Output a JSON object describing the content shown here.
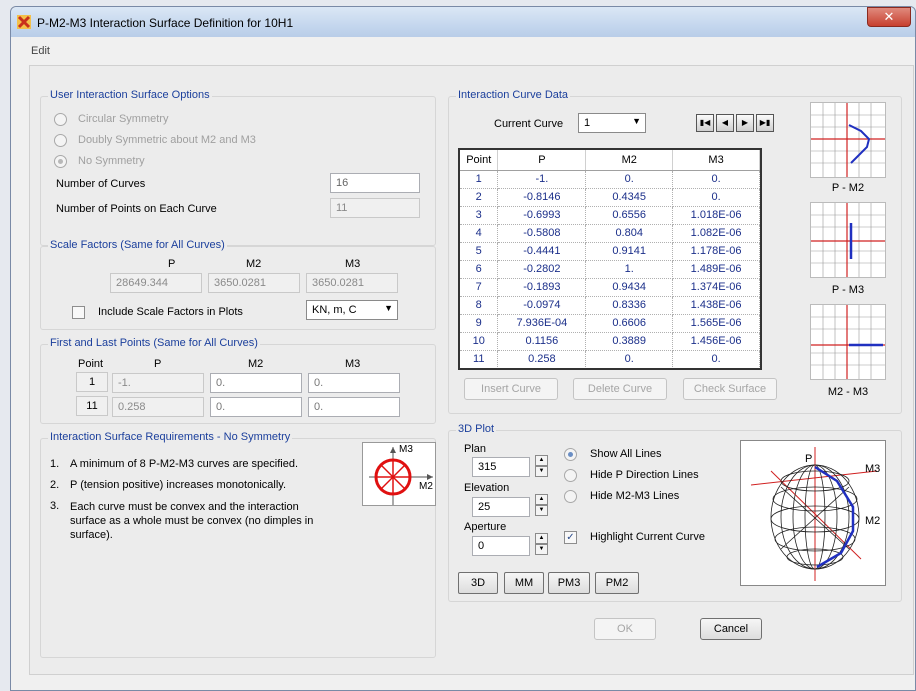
{
  "window": {
    "title": "P-M2-M3 Interaction Surface Definition for 10H1"
  },
  "menu": {
    "edit": "Edit"
  },
  "user_options": {
    "legend": "User Interaction Surface Options",
    "radio_circular": "Circular Symmetry",
    "radio_doubly": "Doubly Symmetric about M2 and M3",
    "radio_none": "No Symmetry",
    "num_curves_label": "Number of Curves",
    "num_curves_value": "16",
    "num_points_label": "Number of Points on Each Curve",
    "num_points_value": "11"
  },
  "scale_factors": {
    "legend": "Scale Factors (Same for All Curves)",
    "col_p": "P",
    "col_m2": "M2",
    "col_m3": "M3",
    "p_value": "28649.344",
    "m2_value": "3650.0281",
    "m3_value": "3650.0281",
    "include_label": "Include Scale Factors in Plots",
    "units": "KN, m, C"
  },
  "first_last": {
    "legend": "First and Last Points (Same for All Curves)",
    "col_point": "Point",
    "col_p": "P",
    "col_m2": "M2",
    "col_m3": "M3",
    "first": {
      "point": "1",
      "p": "-1.",
      "m2": "0.",
      "m3": "0."
    },
    "last": {
      "point": "11",
      "p": "0.258",
      "m2": "0.",
      "m3": "0."
    }
  },
  "requirements": {
    "legend": "Interaction Surface Requirements - No Symmetry",
    "items": [
      {
        "num": "1.",
        "text": "A minimum of 8 P-M2-M3 curves are specified."
      },
      {
        "num": "2.",
        "text": "P (tension positive) increases monotonically."
      },
      {
        "num": "3.",
        "text": "Each curve must be convex and the interaction surface as a whole must be convex (no dimples in surface)."
      }
    ],
    "diagram_m3": "M3",
    "diagram_m2": "M2"
  },
  "curve_data": {
    "legend": "Interaction Curve Data",
    "current_label": "Current Curve",
    "current_value": "1",
    "columns": [
      "Point",
      "P",
      "M2",
      "M3"
    ],
    "rows": [
      [
        "1",
        "-1.",
        "0.",
        "0."
      ],
      [
        "2",
        "-0.8146",
        "0.4345",
        "0."
      ],
      [
        "3",
        "-0.6993",
        "0.6556",
        "1.018E-06"
      ],
      [
        "4",
        "-0.5808",
        "0.804",
        "1.082E-06"
      ],
      [
        "5",
        "-0.4441",
        "0.9141",
        "1.178E-06"
      ],
      [
        "6",
        "-0.2802",
        "1.",
        "1.489E-06"
      ],
      [
        "7",
        "-0.1893",
        "0.9434",
        "1.374E-06"
      ],
      [
        "8",
        "-0.0974",
        "0.8336",
        "1.438E-06"
      ],
      [
        "9",
        "7.936E-04",
        "0.6606",
        "1.565E-06"
      ],
      [
        "10",
        "0.1156",
        "0.3889",
        "1.456E-06"
      ],
      [
        "11",
        "0.258",
        "0.",
        "0."
      ]
    ],
    "insert_curve": "Insert Curve",
    "delete_curve": "Delete Curve",
    "check_surface": "Check Surface",
    "thumb_pm2": "P - M2",
    "thumb_pm3": "P - M3",
    "thumb_m2m3": "M2 - M3"
  },
  "plot3d": {
    "legend": "3D Plot",
    "plan_label": "Plan",
    "plan_value": "315",
    "elevation_label": "Elevation",
    "elevation_value": "25",
    "aperture_label": "Aperture",
    "aperture_value": "0",
    "show_all": "Show All Lines",
    "hide_p": "Hide P Direction Lines",
    "hide_m2m3": "Hide M2-M3 Lines",
    "highlight": "Highlight Current Curve",
    "btn_3d": "3D",
    "btn_mm": "MM",
    "btn_pm3": "PM3",
    "btn_pm2": "PM2",
    "axis_p": "P",
    "axis_m3": "M3",
    "axis_m2": "M2"
  },
  "footer": {
    "ok": "OK",
    "cancel": "Cancel"
  },
  "colors": {
    "accent": "#1b3f9c",
    "close": "#c9443a",
    "highlight_curve": "#2030c0"
  }
}
